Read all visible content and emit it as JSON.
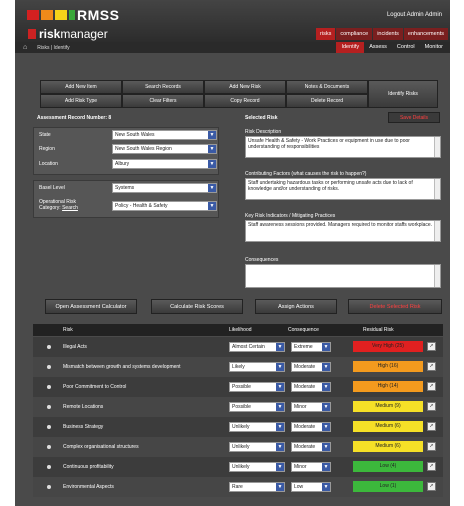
{
  "app": {
    "logo_text": "RMSS",
    "brand_strong": "risk",
    "brand_light": "manager",
    "logout": "Logout Admin Admin"
  },
  "main_tabs": [
    "risks",
    "compliance",
    "incidents",
    "enhancements"
  ],
  "breadcrumb": "Risks | Identify",
  "sub_tabs": [
    "Identify",
    "Assess",
    "Control",
    "Monitor"
  ],
  "toolbar": {
    "row1": [
      "Add New Item",
      "Search Records",
      "Add New Risk",
      "Notes & Documents"
    ],
    "row2": [
      "Add Risk Type",
      "Clear Filters",
      "Copy Record",
      "Delete Record"
    ],
    "identify": "Identify Risks"
  },
  "record": {
    "label": "Assessment Record Number:",
    "number": "8"
  },
  "filters": [
    {
      "label": "State",
      "value": "New South Wales"
    },
    {
      "label": "Region",
      "value": "New South Wales Region"
    },
    {
      "label": "Location",
      "value": "Albury"
    }
  ],
  "basel": {
    "label": "Basel Level",
    "value": "Systems"
  },
  "operational": {
    "label1": "Operational Risk",
    "label2": "Category:",
    "search": "Search",
    "value": "Policy - Health & Safety"
  },
  "selected_risk": {
    "title": "Selected Risk",
    "save": "Save Details",
    "desc_label": "Risk Description",
    "desc": "Unsafe Health & Safety - Work Practices or equipment in use due to poor understanding of responsibilities",
    "factors_label": "Contributing Factors (what causes the risk to happen?)",
    "factors": "Staff undertaking hazardous tasks or performing unsafe acts due to lack of knowledge and/or understanding of risks.",
    "kri_label": "Key Risk Indicators / Mitigating Practices",
    "kri": "Staff awareness sessions provided. Managers required to monitor staffs workplace.",
    "cons_label": "Consequences",
    "cons": ""
  },
  "actions": [
    "Open Assessment Calculator",
    "Calculate Risk Scores",
    "Assign Actions",
    "Delete Selected Risk"
  ],
  "table": {
    "headers": [
      "Risk",
      "Likelihood",
      "Consequence",
      "Residual Risk"
    ],
    "rows": [
      {
        "risk": "Illegal Acts",
        "likelihood": "Almost Certain",
        "consequence": "Extreme",
        "residual": "Very High (25)",
        "color": "#e02020"
      },
      {
        "risk": "Mismatch between growth and systems development",
        "likelihood": "Likely",
        "consequence": "Moderate",
        "residual": "High (16)",
        "color": "#f39a1e"
      },
      {
        "risk": "Poor Commitment to Control",
        "likelihood": "Possible",
        "consequence": "Moderate",
        "residual": "High (14)",
        "color": "#f39a1e"
      },
      {
        "risk": "Remote Locations",
        "likelihood": "Possible",
        "consequence": "Minor",
        "residual": "Medium (9)",
        "color": "#f5e027"
      },
      {
        "risk": "Business Strategy",
        "likelihood": "Unlikely",
        "consequence": "Moderate",
        "residual": "Medium (6)",
        "color": "#f5e027"
      },
      {
        "risk": "Complex organisational structures",
        "likelihood": "Unlikely",
        "consequence": "Moderate",
        "residual": "Medium (6)",
        "color": "#f5e027"
      },
      {
        "risk": "Continuous profitability",
        "likelihood": "Unlikely",
        "consequence": "Minor",
        "residual": "Low (4)",
        "color": "#3cb83c"
      },
      {
        "risk": "Environmental Aspects",
        "likelihood": "Rare",
        "consequence": "Low",
        "residual": "Low (1)",
        "color": "#3cb83c"
      }
    ]
  }
}
